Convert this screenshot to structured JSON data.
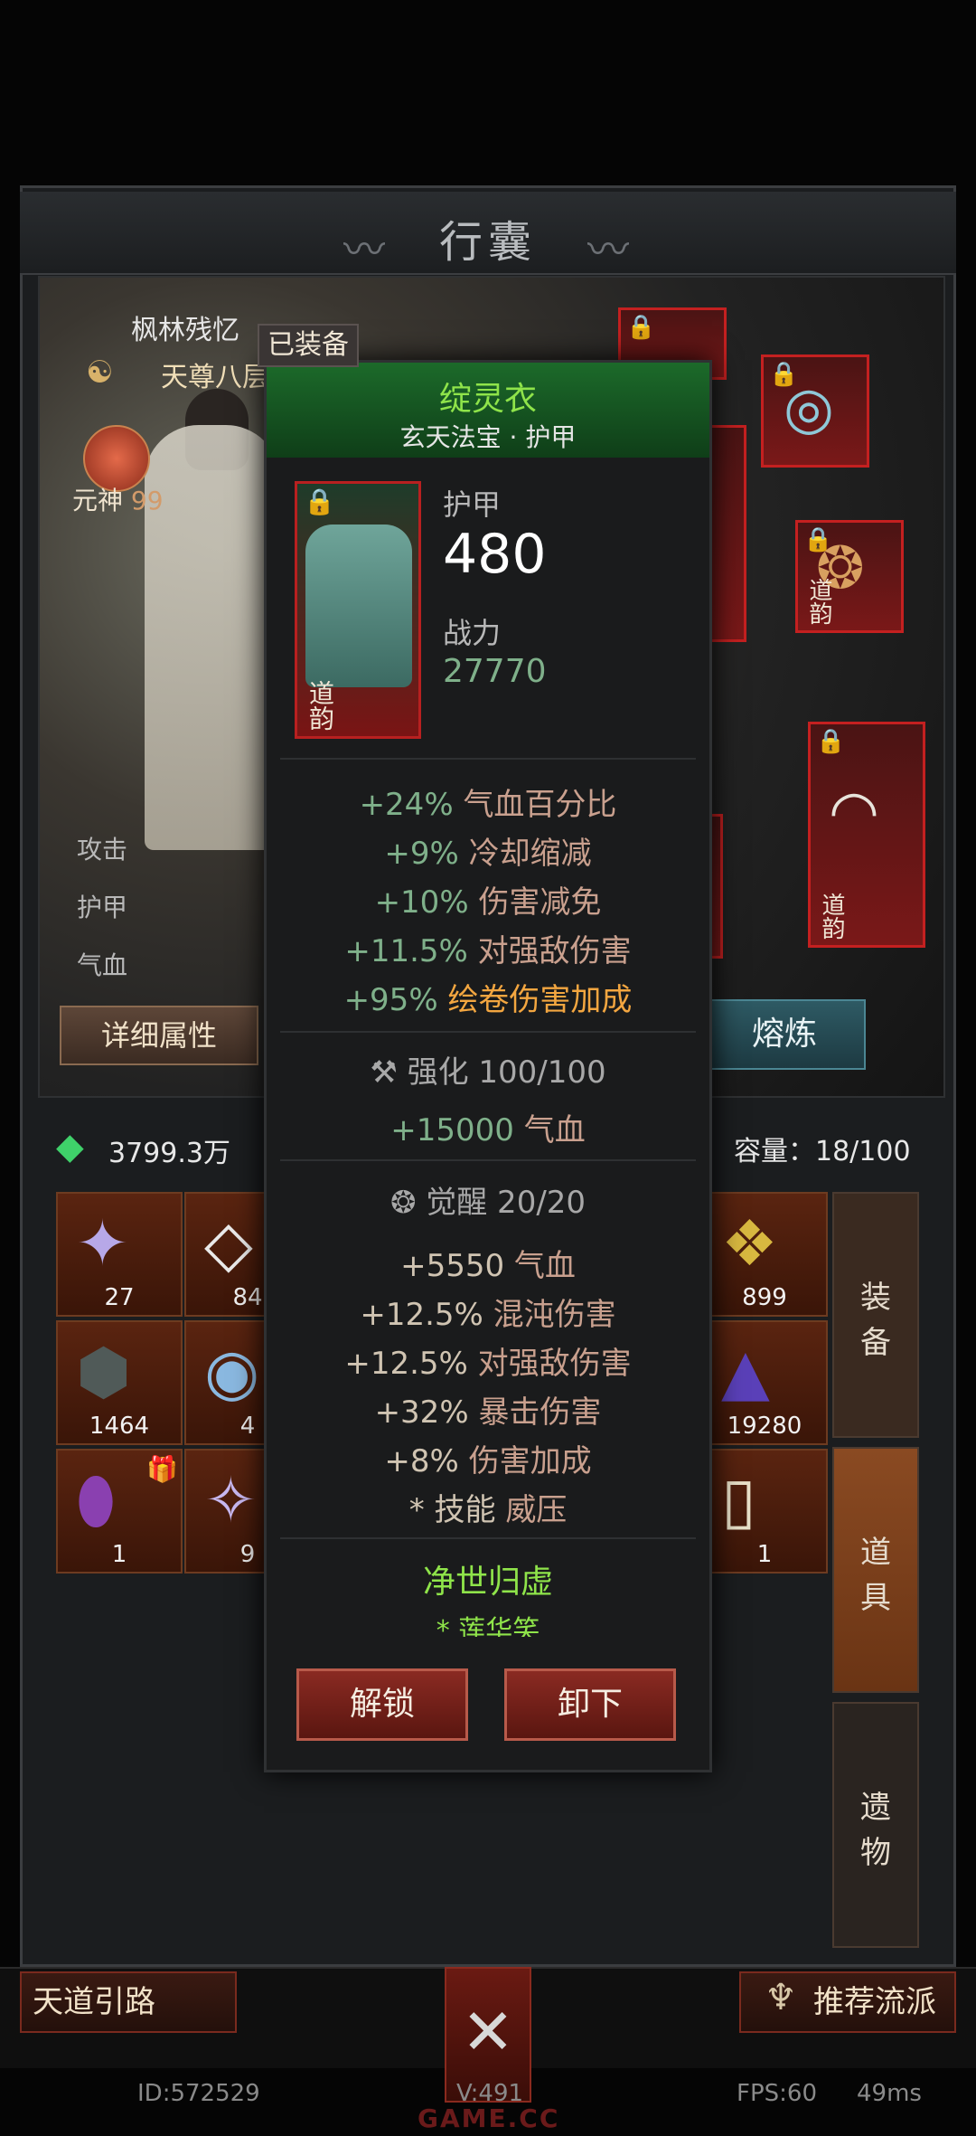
{
  "window": {
    "title": "行囊"
  },
  "character": {
    "name": "枫林残忆",
    "rank": "天尊八层",
    "yuanshen_label": "元神",
    "yuanshen_value": "99",
    "stats": [
      "攻击",
      "护甲",
      "气血"
    ],
    "details_button": "详细属性",
    "refine_button": "熔炼"
  },
  "equip_slots": {
    "daoyun_label": "道韵"
  },
  "inventory": {
    "currency": "3799.3万",
    "capacity": "容量：18/100",
    "cells": [
      {
        "count": "27",
        "icon": "crystal-cluster"
      },
      {
        "count": "84",
        "icon": "white-shard"
      },
      {
        "count": "899",
        "icon": "color-stones"
      },
      {
        "count": "1464",
        "icon": "green-vein-rock"
      },
      {
        "count": "4",
        "icon": "blue-orb"
      },
      {
        "count": "19280",
        "icon": "purple-pile"
      },
      {
        "count": "1",
        "icon": "purple-egg"
      },
      {
        "count": "9",
        "icon": "crystal-shards"
      },
      {
        "count": "1",
        "icon": "scroll-card"
      }
    ],
    "tabs": [
      "装备",
      "道具",
      "遗物"
    ]
  },
  "popup": {
    "badge": "已装备",
    "name": "绽灵衣",
    "subtitle": "玄天法宝 · 护甲",
    "daoyun": "道韵",
    "armor_label": "护甲",
    "armor_value": "480",
    "power_label": "战力",
    "power_value": "27770",
    "base_stats": [
      {
        "value": "+24%",
        "name": "气血百分比"
      },
      {
        "value": "+9%",
        "name": "冷却缩减"
      },
      {
        "value": "+10%",
        "name": "伤害减免"
      },
      {
        "value": "+11.5%",
        "name": "对强敌伤害"
      },
      {
        "value": "+95%",
        "name": "绘卷伤害加成"
      }
    ],
    "enhance_label": "强化 100/100",
    "enhance_bonus": {
      "value": "+15000",
      "name": "气血"
    },
    "awaken_label": "觉醒 20/20",
    "awaken_stats": [
      {
        "value": "+5550",
        "name": "气血"
      },
      {
        "value": "+12.5%",
        "name": "混沌伤害"
      },
      {
        "value": "+12.5%",
        "name": "对强敌伤害"
      },
      {
        "value": "+32%",
        "name": "暴击伤害"
      },
      {
        "value": "+8%",
        "name": "伤害加成"
      }
    ],
    "skill_prefix": "* 技能",
    "skill_name": "威压",
    "set_name": "净世归虚",
    "set_sub": "* 莲华笑",
    "unlock_button": "解锁",
    "unequip_button": "卸下"
  },
  "bottom": {
    "left_button": "天道引路",
    "right_button": "推荐流派",
    "id": "ID:572529",
    "version": "V:491",
    "fps": "FPS:60",
    "latency": "49ms",
    "watermark": "GAME.CC"
  },
  "colors": {
    "rarity_green": "#8fe44a",
    "stat_green": "#7fb08a",
    "highlight_orange": "#f3a640",
    "slot_red": "#c42020"
  }
}
